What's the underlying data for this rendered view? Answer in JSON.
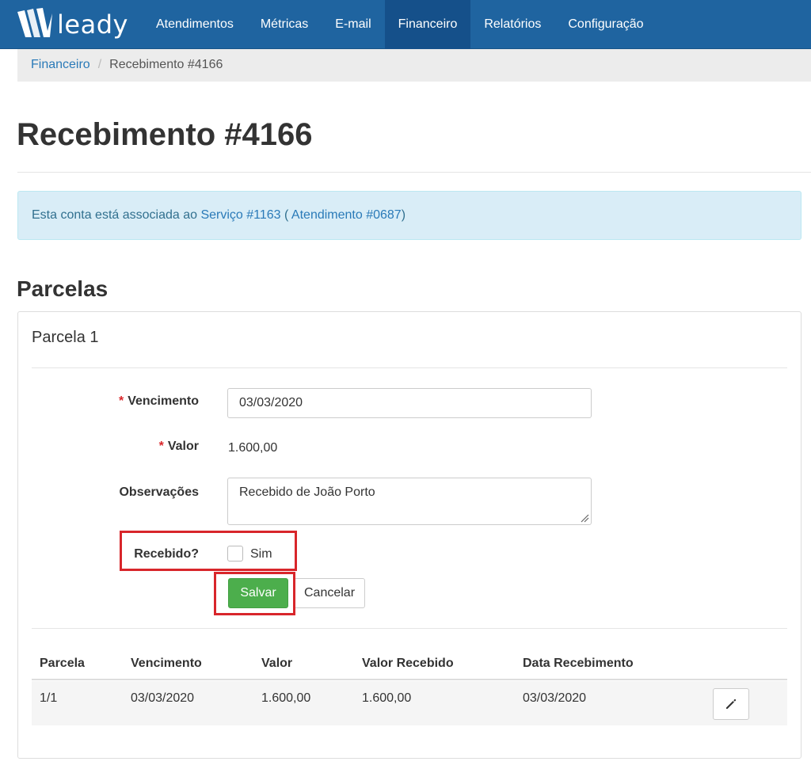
{
  "brand": {
    "name": "leady",
    "logo_icon": "leady-logo-icon"
  },
  "nav": {
    "items": [
      {
        "label": "Atendimentos",
        "active": false
      },
      {
        "label": "Métricas",
        "active": false
      },
      {
        "label": "E-mail",
        "active": false
      },
      {
        "label": "Financeiro",
        "active": true
      },
      {
        "label": "Relatórios",
        "active": false
      },
      {
        "label": "Configuração",
        "active": false
      }
    ]
  },
  "breadcrumb": {
    "parent": "Financeiro",
    "separator": "/",
    "current": "Recebimento #4166"
  },
  "page": {
    "title": "Recebimento #4166"
  },
  "alert": {
    "prefix": "Esta conta está associada ao ",
    "service_link": "Serviço #1163",
    "open_paren": " ( ",
    "attendance_link": "Atendimento #0687",
    "close_paren": ")"
  },
  "section": {
    "title": "Parcelas"
  },
  "panel": {
    "title": "Parcela 1",
    "form": {
      "required_mark": "*",
      "vencimento_label": "Vencimento",
      "vencimento_value": "03/03/2020",
      "valor_label": "Valor",
      "valor_value": "1.600,00",
      "observacoes_label": "Observações",
      "observacoes_value": "Recebido de João Porto",
      "recebido_label": "Recebido?",
      "recebido_option": "Sim",
      "recebido_checked": false,
      "save_label": "Salvar",
      "cancel_label": "Cancelar"
    },
    "table": {
      "headers": [
        "Parcela",
        "Vencimento",
        "Valor",
        "Valor Recebido",
        "Data Recebimento"
      ],
      "rows": [
        {
          "cells": [
            "1/1",
            "03/03/2020",
            "1.600,00",
            "1.600,00",
            "03/03/2020"
          ],
          "action_icon": "pencil-icon"
        }
      ]
    }
  },
  "colors": {
    "navbar": "#1f64a0",
    "navbar_active": "#15508a",
    "link": "#2a7ab8",
    "alert_bg": "#d9edf7",
    "alert_text": "#31708f",
    "success": "#4cae4c",
    "highlight": "#d8262b",
    "required": "#d9262a"
  }
}
